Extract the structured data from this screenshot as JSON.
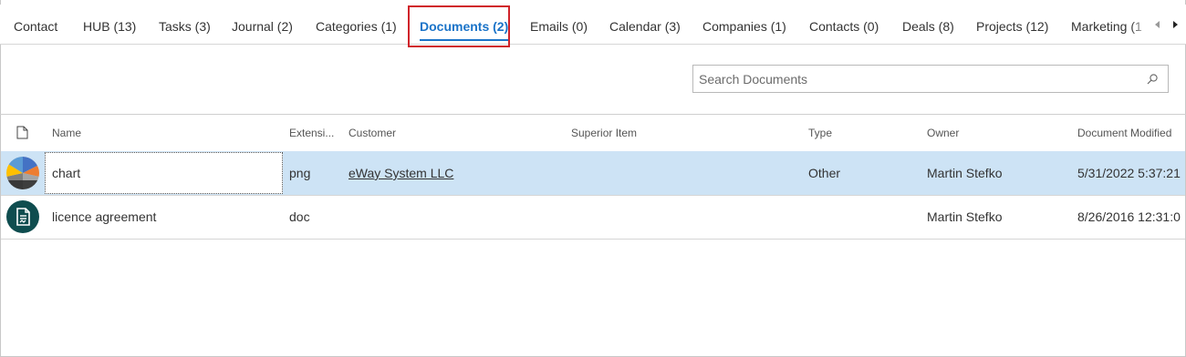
{
  "tabs": [
    {
      "label": "Contact"
    },
    {
      "label": "HUB (13)"
    },
    {
      "label": "Tasks (3)"
    },
    {
      "label": "Journal (2)"
    },
    {
      "label": "Categories (1)"
    },
    {
      "label": "Documents (2)",
      "active": true
    },
    {
      "label": "Emails (0)"
    },
    {
      "label": "Calendar (3)"
    },
    {
      "label": "Companies (1)"
    },
    {
      "label": "Contacts (0)"
    },
    {
      "label": "Deals (8)"
    },
    {
      "label": "Projects (12)"
    },
    {
      "label": "Marketing (1"
    }
  ],
  "search": {
    "placeholder": "Search Documents",
    "value": ""
  },
  "grid": {
    "columns": [
      "Name",
      "Extensi...",
      "Customer",
      "Superior Item",
      "Type",
      "Owner",
      "Document Modified"
    ],
    "rows": [
      {
        "icon": "chart-thumbnail",
        "name": "chart",
        "extension": "png",
        "customer": "eWay System LLC",
        "superior_item": "",
        "type": "Other",
        "owner": "Martin Stefko",
        "modified": "5/31/2022 5:37:21",
        "selected": true
      },
      {
        "icon": "document-icon",
        "name": "licence agreement",
        "extension": "doc",
        "customer": "",
        "superior_item": "",
        "type": "",
        "owner": "Martin Stefko",
        "modified": "8/26/2016 12:31:0",
        "selected": false
      }
    ]
  },
  "colors": {
    "accent": "#1a73c8",
    "highlight_outline": "#d0232a",
    "selected_row": "#cde3f5",
    "doc_avatar": "#0f4d4f"
  }
}
